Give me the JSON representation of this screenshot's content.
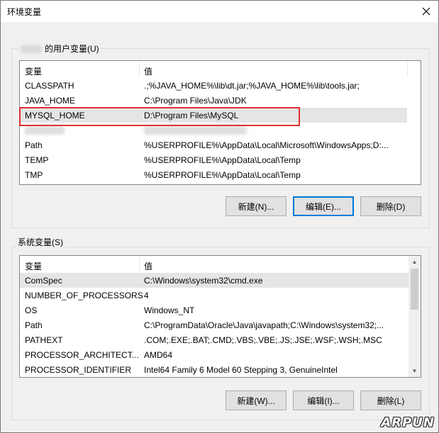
{
  "window": {
    "title": "环境变量",
    "close_icon": "close-icon"
  },
  "user_vars": {
    "group_label": "的用户变量(U)",
    "columns": [
      "变量",
      "值"
    ],
    "rows": [
      {
        "name": "CLASSPATH",
        "value": ".;%JAVA_HOME%\\lib\\dt.jar;%JAVA_HOME%\\lib\\tools.jar;"
      },
      {
        "name": "JAVA_HOME",
        "value": "C:\\Program Files\\Java\\JDK"
      },
      {
        "name": "MYSQL_HOME",
        "value": "D:\\Program Files\\MySQL",
        "selected": true
      },
      {
        "name": "",
        "value": "",
        "blurred": true
      },
      {
        "name": "Path",
        "value": "%USERPROFILE%\\AppData\\Local\\Microsoft\\WindowsApps;D:..."
      },
      {
        "name": "TEMP",
        "value": "%USERPROFILE%\\AppData\\Local\\Temp"
      },
      {
        "name": "TMP",
        "value": "%USERPROFILE%\\AppData\\Local\\Temp"
      }
    ],
    "buttons": {
      "new": "新建(N)...",
      "edit": "编辑(E)...",
      "delete": "删除(D)"
    },
    "highlight_color": "#e03030"
  },
  "system_vars": {
    "group_label": "系统变量(S)",
    "columns": [
      "变量",
      "值"
    ],
    "rows": [
      {
        "name": "ComSpec",
        "value": "C:\\Windows\\system32\\cmd.exe",
        "selected": true
      },
      {
        "name": "NUMBER_OF_PROCESSORS",
        "value": "4"
      },
      {
        "name": "OS",
        "value": "Windows_NT"
      },
      {
        "name": "Path",
        "value": "C:\\ProgramData\\Oracle\\Java\\javapath;C:\\Windows\\system32;..."
      },
      {
        "name": "PATHEXT",
        "value": ".COM;.EXE;.BAT;.CMD;.VBS;.VBE;.JS;.JSE;.WSF;.WSH;.MSC"
      },
      {
        "name": "PROCESSOR_ARCHITECT...",
        "value": "AMD64"
      },
      {
        "name": "PROCESSOR_IDENTIFIER",
        "value": "Intel64 Family 6 Model 60 Stepping 3, GenuineIntel"
      }
    ],
    "buttons": {
      "new": "新建(W)...",
      "edit": "编辑(I)...",
      "delete": "删除(L)"
    }
  },
  "watermark": "ARPUN",
  "colors": {
    "accent": "#0078d7",
    "selection": "#e5e5e5",
    "highlight": "#e03030"
  }
}
